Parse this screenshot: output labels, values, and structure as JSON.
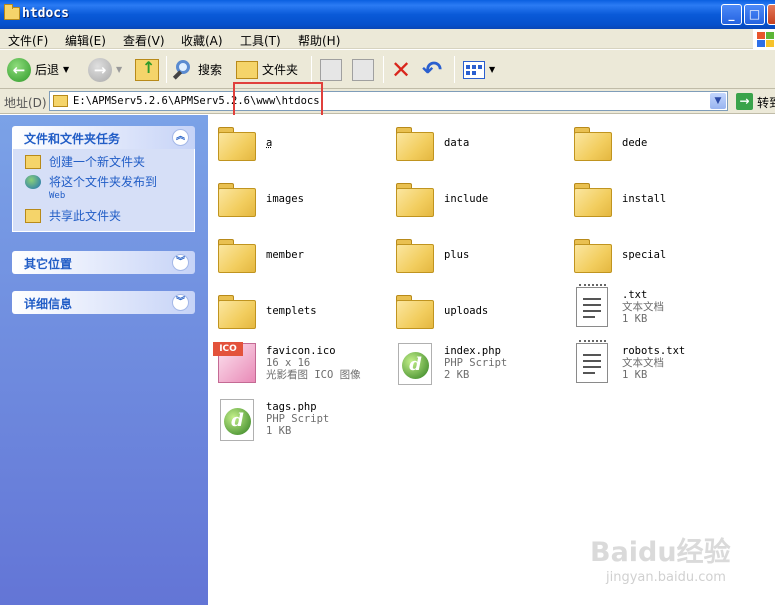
{
  "window": {
    "title": "htdocs"
  },
  "menu": [
    "文件(F)",
    "编辑(E)",
    "查看(V)",
    "收藏(A)",
    "工具(T)",
    "帮助(H)"
  ],
  "toolbar": {
    "back_label": "后退",
    "search_label": "搜索",
    "folders_label": "文件夹"
  },
  "address": {
    "label": "地址(D)",
    "path": "E:\\APMServ5.2.6\\APMServ5.2.6\\www\\htdocs",
    "go_label": "转到"
  },
  "sidebar": {
    "tasks_title": "文件和文件夹任务",
    "tasks": [
      {
        "label": "创建一个新文件夹",
        "icon": "new-folder-icon"
      },
      {
        "label": "将这个文件夹发布到",
        "sub": "Web",
        "icon": "publish-web-icon"
      },
      {
        "label": "共享此文件夹",
        "icon": "share-folder-icon"
      }
    ],
    "other_title": "其它位置",
    "details_title": "详细信息"
  },
  "files": [
    {
      "name": "a",
      "kind": "folder"
    },
    {
      "name": "data",
      "kind": "folder"
    },
    {
      "name": "dede",
      "kind": "folder"
    },
    {
      "name": "images",
      "kind": "folder"
    },
    {
      "name": "include",
      "kind": "folder"
    },
    {
      "name": "install",
      "kind": "folder"
    },
    {
      "name": "member",
      "kind": "folder"
    },
    {
      "name": "plus",
      "kind": "folder"
    },
    {
      "name": "special",
      "kind": "folder"
    },
    {
      "name": "templets",
      "kind": "folder"
    },
    {
      "name": "uploads",
      "kind": "folder"
    },
    {
      "name": ".txt",
      "kind": "txt",
      "type": "文本文档",
      "size": "1 KB"
    },
    {
      "name": "favicon.ico",
      "kind": "ico",
      "type": "16 x 16",
      "size": "光影看图 ICO 图像"
    },
    {
      "name": "index.php",
      "kind": "php",
      "type": "PHP Script",
      "size": "2 KB"
    },
    {
      "name": "robots.txt",
      "kind": "txt",
      "type": "文本文档",
      "size": "1 KB"
    },
    {
      "name": "tags.php",
      "kind": "php",
      "type": "PHP Script",
      "size": "1 KB"
    }
  ],
  "watermark": {
    "line1": "Baidu经验",
    "line2": "jingyan.baidu.com"
  },
  "colors": {
    "titlebar": "#0a5ad8",
    "sidebar": "#6f8ee0",
    "link": "#215dc6",
    "highlight": "#e0403c"
  }
}
